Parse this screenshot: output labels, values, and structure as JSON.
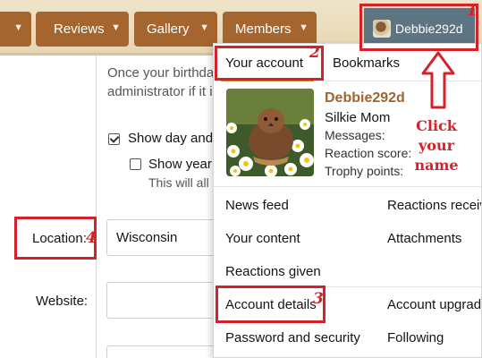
{
  "nav": {
    "tabs": [
      {
        "label": "Reviews"
      },
      {
        "label": "Gallery"
      },
      {
        "label": "Members"
      }
    ],
    "user": {
      "name": "Debbie292d"
    }
  },
  "page": {
    "birthday_note_1": "Once your birthda",
    "birthday_note_2": "administrator if it i",
    "show_day_label": "Show day and",
    "show_day_checked": true,
    "show_year_label": "Show year",
    "show_year_checked": false,
    "show_year_note": "This will all",
    "location_label": "Location:",
    "location_value": "Wisconsin",
    "website_label": "Website:"
  },
  "menu": {
    "tabs": {
      "your_account": "Your account",
      "bookmarks": "Bookmarks"
    },
    "profile": {
      "username": "Debbie292d",
      "user_title": "Silkie Mom",
      "messages_label": "Messages:",
      "reaction_label": "Reaction score:",
      "trophy_label": "Trophy points:"
    },
    "links": {
      "news_feed": "News feed",
      "reactions_received": "Reactions receiv",
      "your_content": "Your content",
      "attachments": "Attachments",
      "reactions_given": "Reactions given",
      "account_details": "Account details",
      "account_upgrades": "Account upgrad",
      "password_security": "Password and security",
      "following": "Following"
    }
  },
  "annotations": {
    "n1": "1",
    "n2": "2",
    "n3": "3",
    "n4": "4",
    "click_1": "Click",
    "click_2": "your",
    "click_3": "name"
  },
  "colors": {
    "annotation_red": "#d3222a",
    "nav_tab": "#a5652f",
    "user_box": "#5d7483",
    "username_link": "#9e6530"
  }
}
